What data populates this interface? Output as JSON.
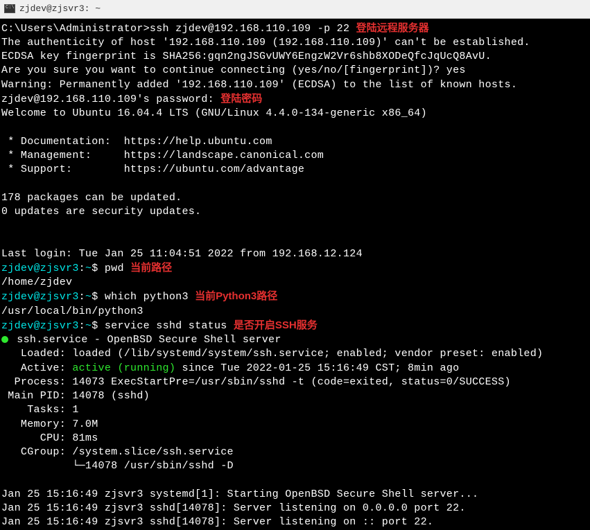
{
  "titlebar": {
    "text": "zjdev@zjsvr3: ~"
  },
  "lines": [
    {
      "segs": [
        {
          "t": "C:\\Users\\Administrator>ssh zjdev@192.168.110.109 -p 22 "
        },
        {
          "t": "登陆远程服务器",
          "c": "red-anno"
        }
      ]
    },
    {
      "segs": [
        {
          "t": "The authenticity of host '192.168.110.109 (192.168.110.109)' can't be established."
        }
      ]
    },
    {
      "segs": [
        {
          "t": "ECDSA key fingerprint is SHA256:gqn2ngJSGvUWY6EngzW2Vr6shb8XODeQfcJqUcQ8AvU."
        }
      ]
    },
    {
      "segs": [
        {
          "t": "Are you sure you want to continue connecting (yes/no/[fingerprint])? yes"
        }
      ]
    },
    {
      "segs": [
        {
          "t": "Warning: Permanently added '192.168.110.109' (ECDSA) to the list of known hosts."
        }
      ]
    },
    {
      "segs": [
        {
          "t": "zjdev@192.168.110.109's password: "
        },
        {
          "t": "登陆密码",
          "c": "red-anno"
        }
      ]
    },
    {
      "segs": [
        {
          "t": "Welcome to Ubuntu 16.04.4 LTS (GNU/Linux 4.4.0-134-generic x86_64)"
        }
      ]
    },
    {
      "segs": [
        {
          "t": ""
        }
      ]
    },
    {
      "segs": [
        {
          "t": " * Documentation:  https://help.ubuntu.com"
        }
      ]
    },
    {
      "segs": [
        {
          "t": " * Management:     https://landscape.canonical.com"
        }
      ]
    },
    {
      "segs": [
        {
          "t": " * Support:        https://ubuntu.com/advantage"
        }
      ]
    },
    {
      "segs": [
        {
          "t": ""
        }
      ]
    },
    {
      "segs": [
        {
          "t": "178 packages can be updated."
        }
      ]
    },
    {
      "segs": [
        {
          "t": "0 updates are security updates."
        }
      ]
    },
    {
      "segs": [
        {
          "t": ""
        }
      ]
    },
    {
      "segs": [
        {
          "t": ""
        }
      ]
    },
    {
      "segs": [
        {
          "t": "Last login: Tue Jan 25 11:04:51 2022 from 192.168.12.124"
        }
      ]
    },
    {
      "segs": [
        {
          "t": "zjdev@zjsvr3",
          "c": "cyan"
        },
        {
          "t": ":"
        },
        {
          "t": "~",
          "c": "cyan"
        },
        {
          "t": "$ pwd "
        },
        {
          "t": "当前路径",
          "c": "red-anno"
        }
      ]
    },
    {
      "segs": [
        {
          "t": "/home/zjdev"
        }
      ]
    },
    {
      "segs": [
        {
          "t": "zjdev@zjsvr3",
          "c": "cyan"
        },
        {
          "t": ":"
        },
        {
          "t": "~",
          "c": "cyan"
        },
        {
          "t": "$ which python3 "
        },
        {
          "t": "当前Python3路径",
          "c": "red-anno"
        }
      ]
    },
    {
      "segs": [
        {
          "t": "/usr/local/bin/python3"
        }
      ]
    },
    {
      "segs": [
        {
          "t": "zjdev@zjsvr3",
          "c": "cyan"
        },
        {
          "t": ":"
        },
        {
          "t": "~",
          "c": "cyan"
        },
        {
          "t": "$ service sshd status "
        },
        {
          "t": "是否开启SSH服务",
          "c": "red-anno"
        }
      ]
    },
    {
      "segs": [
        {
          "dot": true
        },
        {
          "t": " ssh.service - OpenBSD Secure Shell server"
        }
      ]
    },
    {
      "segs": [
        {
          "t": "   Loaded: loaded (/lib/systemd/system/ssh.service; enabled; vendor preset: enabled)"
        }
      ]
    },
    {
      "segs": [
        {
          "t": "   Active: "
        },
        {
          "t": "active (running)",
          "c": "green"
        },
        {
          "t": " since Tue 2022-01-25 15:16:49 CST; 8min ago"
        }
      ]
    },
    {
      "segs": [
        {
          "t": "  Process: 14073 ExecStartPre=/usr/sbin/sshd -t (code=exited, status=0/SUCCESS)"
        }
      ]
    },
    {
      "segs": [
        {
          "t": " Main PID: 14078 (sshd)"
        }
      ]
    },
    {
      "segs": [
        {
          "t": "    Tasks: 1"
        }
      ]
    },
    {
      "segs": [
        {
          "t": "   Memory: 7.0M"
        }
      ]
    },
    {
      "segs": [
        {
          "t": "      CPU: 81ms"
        }
      ]
    },
    {
      "segs": [
        {
          "t": "   CGroup: /system.slice/ssh.service"
        }
      ]
    },
    {
      "segs": [
        {
          "t": "           └─14078 /usr/sbin/sshd -D"
        }
      ]
    },
    {
      "segs": [
        {
          "t": ""
        }
      ]
    },
    {
      "segs": [
        {
          "t": "Jan 25 15:16:49 zjsvr3 systemd[1]: Starting OpenBSD Secure Shell server..."
        }
      ]
    },
    {
      "segs": [
        {
          "t": "Jan 25 15:16:49 zjsvr3 sshd[14078]: Server listening on 0.0.0.0 port 22."
        }
      ]
    },
    {
      "segs": [
        {
          "t": "Jan 25 15:16:49 zjsvr3 sshd[14078]: Server listening on :: port 22."
        }
      ]
    }
  ]
}
